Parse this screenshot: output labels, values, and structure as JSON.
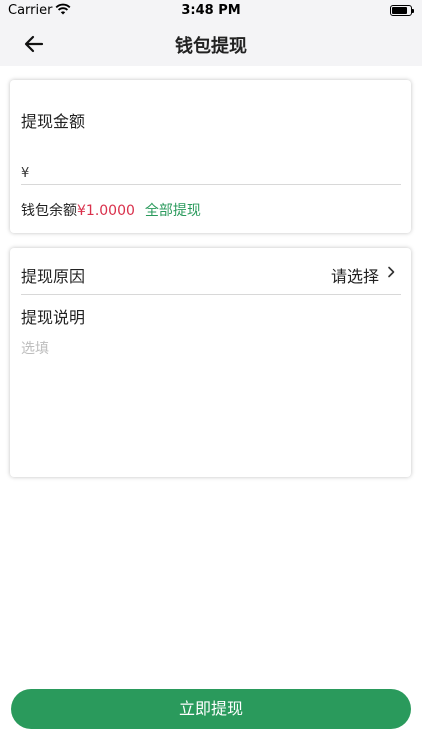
{
  "status_bar": {
    "carrier": "Carrier",
    "time": "3:48 PM"
  },
  "nav": {
    "title": "钱包提现",
    "back_icon": "arrow-left-icon"
  },
  "amount_card": {
    "label": "提现金额",
    "currency_symbol": "¥",
    "input_value": "",
    "balance_label": "钱包余额",
    "balance_value": "¥1.0000",
    "withdraw_all_label": "全部提现"
  },
  "reason_card": {
    "reason_label": "提现原因",
    "reason_value": "请选择",
    "description_label": "提现说明",
    "description_placeholder": "选填"
  },
  "submit_label": "立即提现",
  "colors": {
    "accent": "#2a9a5c",
    "balance": "#d9304b",
    "nav_bg": "#f4f4f6"
  }
}
